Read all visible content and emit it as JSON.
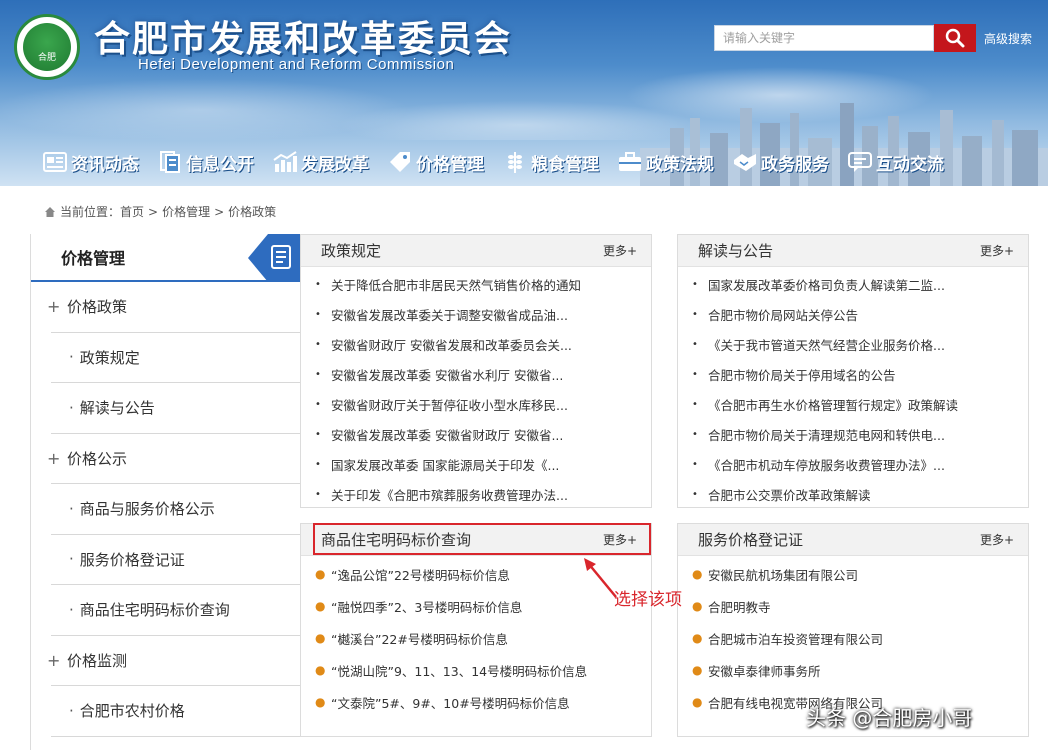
{
  "header": {
    "logo_text": "合肥",
    "title": "合肥市发展和改革委员会",
    "subtitle": "Hefei Development and Reform Commission",
    "search_placeholder": "请输入关键字",
    "advanced_search": "高级搜索"
  },
  "nav": {
    "items": [
      {
        "label": "资讯动态",
        "icon": "newspaper-icon"
      },
      {
        "label": "信息公开",
        "icon": "document-icon"
      },
      {
        "label": "发展改革",
        "icon": "growth-chart-icon"
      },
      {
        "label": "价格管理",
        "icon": "price-tag-icon"
      },
      {
        "label": "粮食管理",
        "icon": "wheat-icon"
      },
      {
        "label": "政策法规",
        "icon": "briefcase-icon"
      },
      {
        "label": "政务服务",
        "icon": "handshake-icon"
      },
      {
        "label": "互动交流",
        "icon": "chat-icon"
      }
    ]
  },
  "breadcrumb": {
    "prefix": "当前位置：",
    "items": [
      "首页",
      "价格管理",
      "价格政策"
    ],
    "separator": ">"
  },
  "sidebar": {
    "title": "价格管理",
    "items": [
      {
        "label": "价格政策",
        "type": "group"
      },
      {
        "label": "政策规定",
        "type": "sub"
      },
      {
        "label": "解读与公告",
        "type": "sub"
      },
      {
        "label": "价格公示",
        "type": "group"
      },
      {
        "label": "商品与服务价格公示",
        "type": "sub"
      },
      {
        "label": "服务价格登记证",
        "type": "sub"
      },
      {
        "label": "商品住宅明码标价查询",
        "type": "sub"
      },
      {
        "label": "价格监测",
        "type": "group"
      },
      {
        "label": "合肥市农村价格",
        "type": "sub"
      }
    ]
  },
  "panels": {
    "more_label": "更多+",
    "policy": {
      "title": "政策规定",
      "items": [
        "关于降低合肥市非居民天然气销售价格的通知",
        "安徽省发展改革委关于调整安徽省成品油...",
        "安徽省财政厅 安徽省发展和改革委员会关...",
        "安徽省发展改革委 安徽省水利厅 安徽省...",
        "安徽省财政厅关于暂停征收小型水库移民...",
        "安徽省发展改革委 安徽省财政厅 安徽省...",
        "国家发展改革委 国家能源局关于印发《...",
        "关于印发《合肥市殡葬服务收费管理办法..."
      ]
    },
    "interpret": {
      "title": "解读与公告",
      "items": [
        "国家发展改革委价格司负责人解读第二监...",
        "合肥市物价局网站关停公告",
        "《关于我市管道天然气经营企业服务价格...",
        "合肥市物价局关于停用域名的公告",
        "《合肥市再生水价格管理暂行规定》政策解读",
        "合肥市物价局关于清理规范电网和转供电...",
        "《合肥市机动车停放服务收费管理办法》...",
        "合肥市公交票价改革政策解读"
      ]
    },
    "housing": {
      "title": "商品住宅明码标价查询",
      "items": [
        "“逸品公馆”22号楼明码标价信息",
        "“融悦四季”2、3号楼明码标价信息",
        "“樾溪台”22#号楼明码标价信息",
        "“悦湖山院”9、11、13、14号楼明码标价信息",
        "“文泰院”5#、9#、10#号楼明码标价信息"
      ]
    },
    "service": {
      "title": "服务价格登记证",
      "items": [
        "安徽民航机场集团有限公司",
        "合肥明教寺",
        "合肥城市泊车投资管理有限公司",
        "安徽卓泰律师事务所",
        "合肥有线电视宽带网络有限公司"
      ]
    }
  },
  "annotation": {
    "callout": "选择该项",
    "color": "#d9262c"
  },
  "watermark": "头条 @合肥房小哥"
}
